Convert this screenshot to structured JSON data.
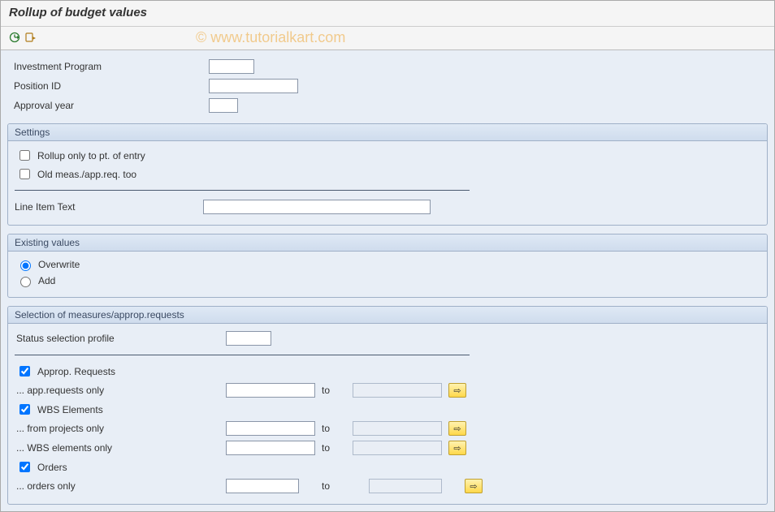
{
  "title": "Rollup of budget values",
  "watermark": "© www.tutorialkart.com",
  "toolbar": {
    "icons": [
      "execute-icon",
      "get-variant-icon"
    ]
  },
  "top_fields": {
    "investment_program": {
      "label": "Investment Program",
      "value": ""
    },
    "position_id": {
      "label": "Position ID",
      "value": ""
    },
    "approval_year": {
      "label": "Approval year",
      "value": ""
    }
  },
  "settings": {
    "title": "Settings",
    "rollup_only": {
      "label": "Rollup only to pt. of entry",
      "checked": false
    },
    "old_meas": {
      "label": "Old meas./app.req. too",
      "checked": false
    },
    "line_item": {
      "label": "Line Item Text",
      "value": ""
    }
  },
  "existing_values": {
    "title": "Existing values",
    "overwrite": {
      "label": "Overwrite",
      "selected": true
    },
    "add": {
      "label": "Add",
      "selected": false
    }
  },
  "selection": {
    "title": "Selection of measures/approp.requests",
    "status_profile": {
      "label": "Status selection profile",
      "value": ""
    },
    "approp_requests": {
      "label": "Approp. Requests",
      "checked": true
    },
    "app_requests_only": {
      "label": "... app.requests only",
      "from": "",
      "to_label": "to",
      "to": ""
    },
    "wbs_elements": {
      "label": "WBS Elements",
      "checked": true
    },
    "from_projects_only": {
      "label": "... from projects only",
      "from": "",
      "to_label": "to",
      "to": ""
    },
    "wbs_elements_only": {
      "label": "... WBS elements only",
      "from": "",
      "to_label": "to",
      "to": ""
    },
    "orders": {
      "label": "Orders",
      "checked": true
    },
    "orders_only": {
      "label": "... orders only",
      "from": "",
      "to_label": "to",
      "to": ""
    }
  }
}
